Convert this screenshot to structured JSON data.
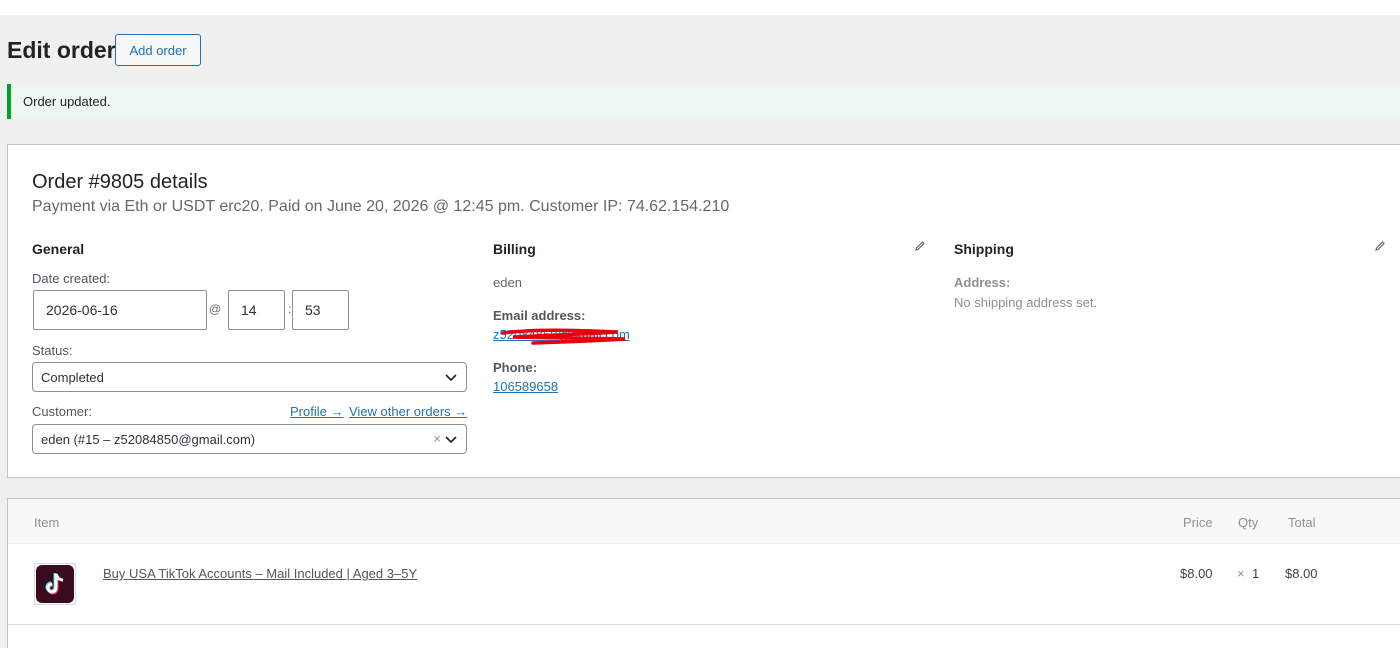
{
  "page": {
    "title": "Edit order",
    "add_order_label": "Add order",
    "notice": "Order updated."
  },
  "order": {
    "title": "Order #9805 details",
    "meta": "Payment via Eth or USDT erc20. Paid on June 20, 2026 @ 12:45 pm. Customer IP: 74.62.154.210"
  },
  "general": {
    "heading": "General",
    "date_label": "Date created:",
    "date_value": "2026-06-16",
    "at_sep": "@",
    "hour": "14",
    "colon_sep": ":",
    "minute": "53",
    "status_label": "Status:",
    "status_value": "Completed",
    "customer_label": "Customer:",
    "profile_link": "Profile →",
    "view_orders_link": "View other orders →",
    "customer_value": "eden (#15 – z52084850@gmail.com)",
    "clear_symbol": "×"
  },
  "billing": {
    "heading": "Billing",
    "name": "eden",
    "email_label": "Email address:",
    "email_value": "z52084850@gmail.com",
    "phone_label": "Phone:",
    "phone_value": "106589658"
  },
  "shipping": {
    "heading": "Shipping",
    "address_label": "Address:",
    "address_value": "No shipping address set."
  },
  "items": {
    "headers": {
      "item": "Item",
      "price": "Price",
      "qty": "Qty",
      "total": "Total"
    },
    "rows": [
      {
        "name": "Buy USA TikTok Accounts – Mail Included | Aged 3–5Y",
        "price": "$8.00",
        "qty_symbol": "×",
        "qty": "1",
        "total": "$8.00",
        "icon": "tiktok-logo-icon"
      }
    ]
  },
  "colors": {
    "accent": "#2271b1",
    "success": "#00a32a",
    "redaction": "#e8000b"
  }
}
